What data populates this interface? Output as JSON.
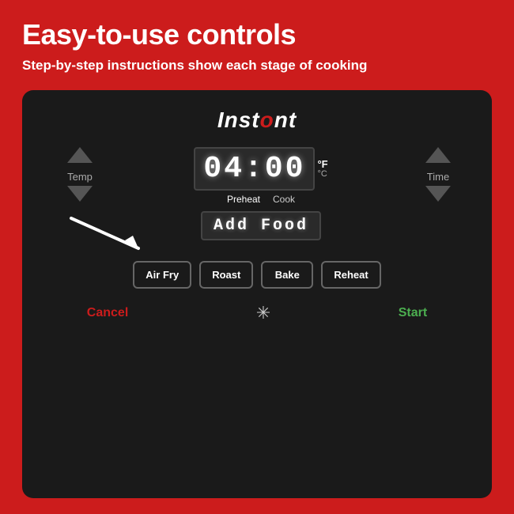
{
  "header": {
    "title": "Easy-to-use controls",
    "subtitle": "Step-by-step instructions show each stage of cooking"
  },
  "device": {
    "brand": "Instant",
    "time_display": "04:00",
    "temp_unit": "°F",
    "temp_unit_secondary": "°C",
    "stage_labels": [
      "Preheat",
      "Cook"
    ],
    "add_food_text": "Add Food",
    "controls": {
      "temp_label": "Temp",
      "time_label": "Time"
    },
    "mode_buttons": [
      "Air Fry",
      "Roast",
      "Bake",
      "Reheat"
    ],
    "cancel_label": "Cancel",
    "start_label": "Start"
  }
}
